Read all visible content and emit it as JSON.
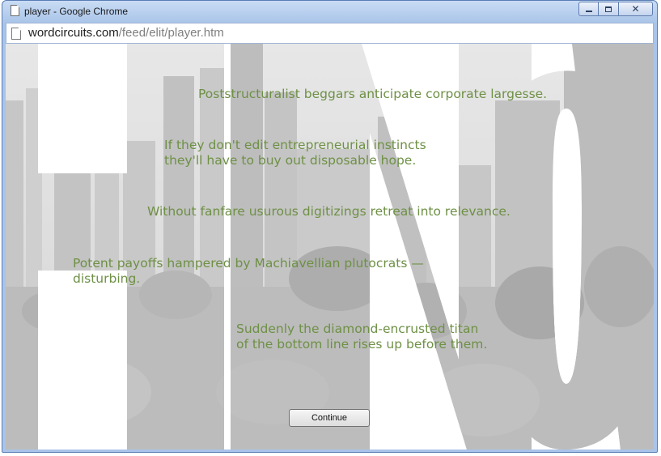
{
  "window": {
    "title": "player - Google Chrome",
    "controls": {
      "minimize": "",
      "maximize": "",
      "close": "✕"
    }
  },
  "address": {
    "host": "wordcircuits.com",
    "path": "/feed/elit/player.htm"
  },
  "content": {
    "lines": [
      "Poststructuralist beggars anticipate corporate largesse.",
      "If they don't edit entrepreneurial instincts",
      "they'll have to buy out disposable hope.",
      "Without fanfare usurous digitizings retreat into relevance.",
      "Potent payoffs hampered by Machiavellian plutocrats —",
      "disturbing.",
      "Suddenly the diamond-encrusted titan",
      "of the bottom line rises up before them."
    ],
    "continue_label": "Continue"
  },
  "colors": {
    "text": "#6e9045",
    "titlebar": "#a9c4e9",
    "background_photo": "#d2d2d2"
  }
}
